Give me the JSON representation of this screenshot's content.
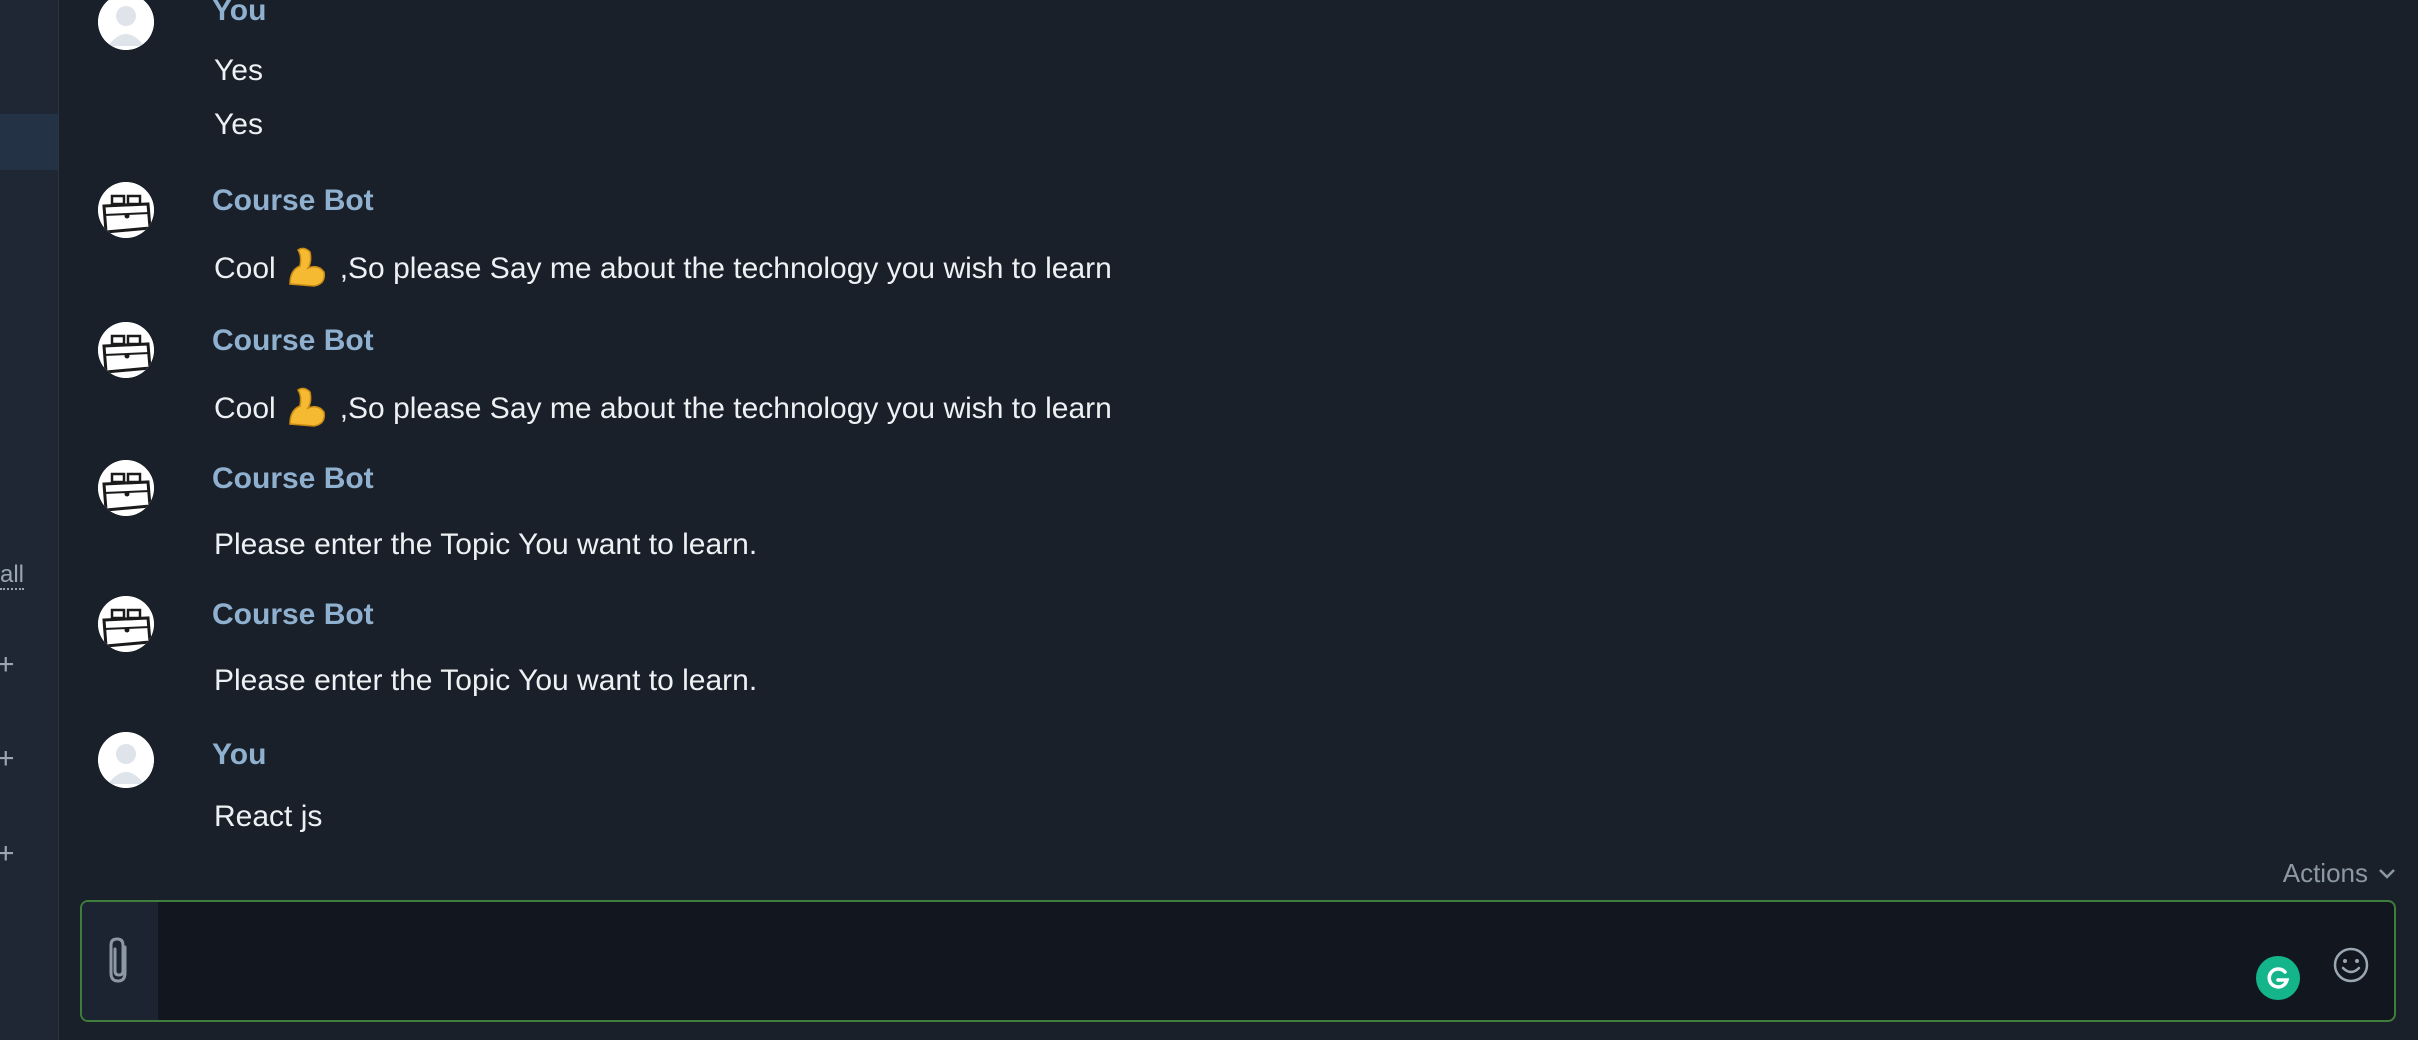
{
  "sidebar": {
    "all_label": "all"
  },
  "messages": [
    {
      "sender": "You",
      "avatar": "user-avatar-icon",
      "lines": [
        "Yes",
        "Yes"
      ]
    },
    {
      "sender": "Course Bot",
      "avatar": "briefcase-avatar-icon",
      "lines": [
        {
          "before": "Cool",
          "emoji": "flexed-biceps-emoji",
          "after": ",So please Say me about the technology you wish to learn"
        }
      ]
    },
    {
      "sender": "Course Bot",
      "avatar": "briefcase-avatar-icon",
      "lines": [
        {
          "before": "Cool",
          "emoji": "flexed-biceps-emoji",
          "after": ",So please Say me about the technology you wish to learn"
        }
      ]
    },
    {
      "sender": "Course Bot",
      "avatar": "briefcase-avatar-icon",
      "lines": [
        "Please enter the Topic You want to learn."
      ]
    },
    {
      "sender": "Course Bot",
      "avatar": "briefcase-avatar-icon",
      "lines": [
        "Please enter the Topic You want to learn."
      ]
    },
    {
      "sender": "You",
      "avatar": "user-avatar-icon",
      "lines": [
        "React js"
      ]
    }
  ],
  "actions_label": "Actions",
  "composer": {
    "value": "",
    "attach_icon": "paperclip-icon",
    "grammarly_icon": "grammarly-icon",
    "emoji_icon": "smiley-icon"
  },
  "colors": {
    "background": "#19202a",
    "sender": "#8fb0cf",
    "composer_border": "#3e7d3b",
    "grammarly": "#15b58c"
  }
}
